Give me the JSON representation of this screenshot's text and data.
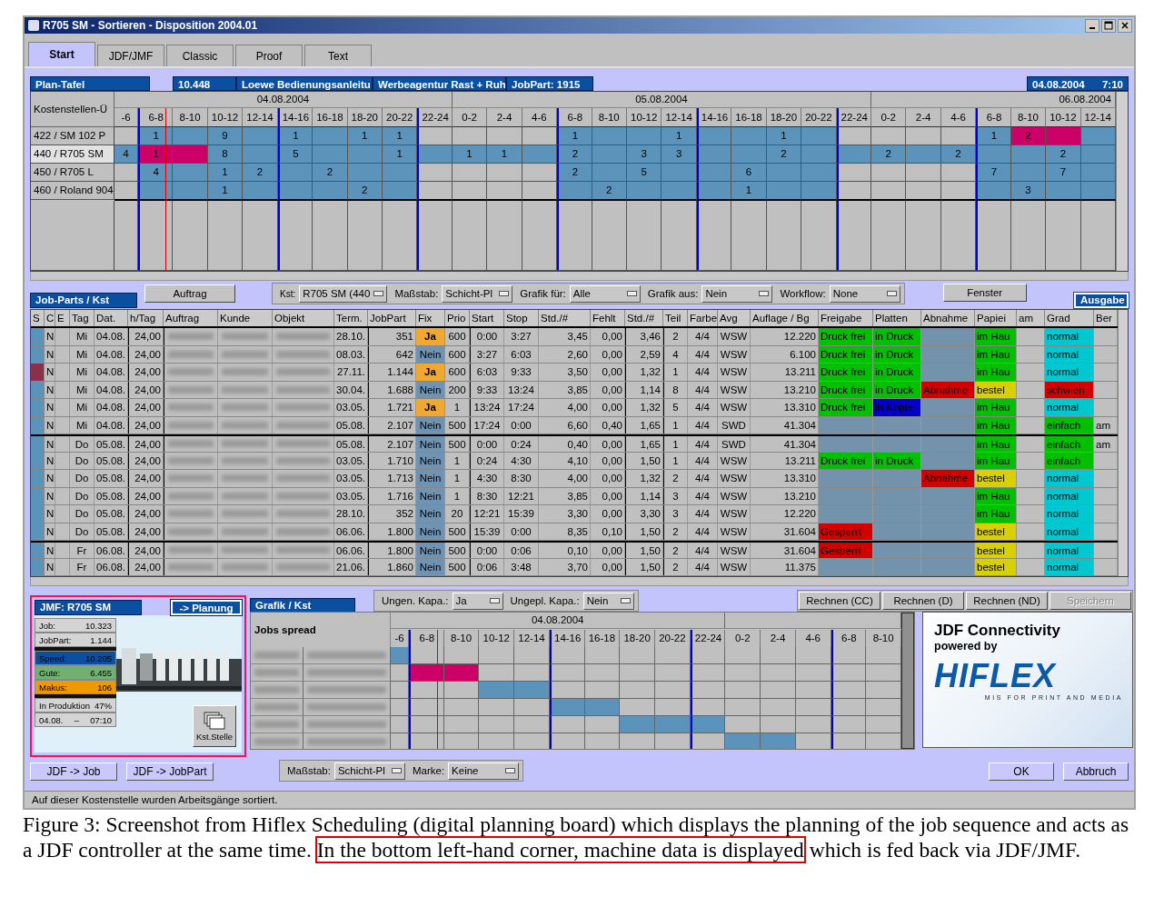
{
  "window": {
    "title": "R705 SM - Sortieren - Disposition 2004.01"
  },
  "tabs": [
    {
      "label": "Start",
      "selected": true
    },
    {
      "label": "JDF/JMF",
      "selected": false
    },
    {
      "label": "Classic",
      "selected": false
    },
    {
      "label": "Proof",
      "selected": false
    },
    {
      "label": "Text",
      "selected": false
    }
  ],
  "plan_header": {
    "title": "Plan-Tafel",
    "fields": [
      "10.448",
      "Loewe Bedienungsanleitu",
      "Werbeagentur Rast + Ruh",
      "JobPart: 1915"
    ],
    "date": "04.08.2004",
    "time": "7:10"
  },
  "plan_board": {
    "corner": "Kostenstellen-Ü",
    "days": [
      {
        "date": "04.08.2004",
        "slots": [
          "-6",
          "6-8",
          "8-10",
          "10-12",
          "12-14",
          "14-16",
          "16-18",
          "18-20",
          "20-22",
          "22-24"
        ]
      },
      {
        "date": "05.08.2004",
        "slots": [
          "0-2",
          "2-4",
          "4-6",
          "6-8",
          "8-10",
          "10-12",
          "12-14",
          "14-16",
          "16-18",
          "18-20",
          "20-22",
          "22-24"
        ]
      },
      {
        "date": "06.08.2004",
        "slots": [
          "0-2",
          "2-4",
          "4-6",
          "6-8",
          "8-10",
          "10-12",
          "12-14"
        ]
      }
    ],
    "rows": [
      {
        "label": "422 / SM 102 P",
        "selected": false,
        "cells": [
          {
            "kind": "idle"
          },
          {
            "kind": "busy",
            "label": "1"
          },
          {
            "kind": "busy"
          },
          {
            "kind": "busy",
            "label": "9"
          },
          {
            "kind": "busy"
          },
          {
            "kind": "busy",
            "label": "1"
          },
          {
            "kind": "busy"
          },
          {
            "kind": "busy",
            "label": "1"
          },
          {
            "kind": "busy",
            "label": "1"
          },
          {
            "kind": "idle"
          },
          {
            "kind": "idle"
          },
          {
            "kind": "idle"
          },
          {
            "kind": "idle"
          },
          {
            "kind": "busy",
            "label": "1"
          },
          {
            "kind": "busy"
          },
          {
            "kind": "busy"
          },
          {
            "kind": "busy",
            "label": "1"
          },
          {
            "kind": "busy"
          },
          {
            "kind": "busy"
          },
          {
            "kind": "busy",
            "label": "1"
          },
          {
            "kind": "busy"
          },
          {
            "kind": "idle"
          },
          {
            "kind": "idle"
          },
          {
            "kind": "idle"
          },
          {
            "kind": "idle"
          },
          {
            "kind": "busy",
            "label": "1"
          },
          {
            "kind": "alert",
            "label": "2"
          },
          {
            "kind": "alert"
          },
          {
            "kind": "busy"
          }
        ]
      },
      {
        "label": "440 / R705 SM",
        "selected": true,
        "cells": [
          {
            "kind": "busy",
            "label": "4"
          },
          {
            "kind": "alert",
            "label": "1"
          },
          {
            "kind": "alert"
          },
          {
            "kind": "busy",
            "label": "8"
          },
          {
            "kind": "busy"
          },
          {
            "kind": "busy",
            "label": "5"
          },
          {
            "kind": "busy"
          },
          {
            "kind": "busy"
          },
          {
            "kind": "busy",
            "label": "1"
          },
          {
            "kind": "busy"
          },
          {
            "kind": "busy",
            "label": "1"
          },
          {
            "kind": "busy",
            "label": "1"
          },
          {
            "kind": "busy"
          },
          {
            "kind": "busy",
            "label": "2"
          },
          {
            "kind": "busy"
          },
          {
            "kind": "busy",
            "label": "3"
          },
          {
            "kind": "busy",
            "label": "3"
          },
          {
            "kind": "busy"
          },
          {
            "kind": "busy"
          },
          {
            "kind": "busy",
            "label": "2"
          },
          {
            "kind": "busy"
          },
          {
            "kind": "busy"
          },
          {
            "kind": "busy",
            "label": "2"
          },
          {
            "kind": "busy"
          },
          {
            "kind": "busy",
            "label": "2"
          },
          {
            "kind": "busy"
          },
          {
            "kind": "busy"
          },
          {
            "kind": "busy",
            "label": "2"
          },
          {
            "kind": "busy"
          }
        ]
      },
      {
        "label": "450 / R705 L",
        "selected": false,
        "cells": [
          {
            "kind": "idle"
          },
          {
            "kind": "busy",
            "label": "4"
          },
          {
            "kind": "busy"
          },
          {
            "kind": "busy",
            "label": "1"
          },
          {
            "kind": "busy",
            "label": "2"
          },
          {
            "kind": "busy"
          },
          {
            "kind": "busy",
            "label": "2"
          },
          {
            "kind": "busy"
          },
          {
            "kind": "busy"
          },
          {
            "kind": "idle"
          },
          {
            "kind": "idle"
          },
          {
            "kind": "idle"
          },
          {
            "kind": "idle"
          },
          {
            "kind": "busy",
            "label": "2"
          },
          {
            "kind": "busy"
          },
          {
            "kind": "busy",
            "label": "5"
          },
          {
            "kind": "busy"
          },
          {
            "kind": "busy"
          },
          {
            "kind": "busy",
            "label": "6"
          },
          {
            "kind": "busy"
          },
          {
            "kind": "busy"
          },
          {
            "kind": "idle"
          },
          {
            "kind": "idle"
          },
          {
            "kind": "idle"
          },
          {
            "kind": "idle"
          },
          {
            "kind": "busy",
            "label": "7"
          },
          {
            "kind": "busy"
          },
          {
            "kind": "busy",
            "label": "7"
          },
          {
            "kind": "busy"
          }
        ]
      },
      {
        "label": "460 / Roland 904",
        "selected": false,
        "cells": [
          {
            "kind": "idle"
          },
          {
            "kind": "busy"
          },
          {
            "kind": "busy"
          },
          {
            "kind": "busy",
            "label": "1"
          },
          {
            "kind": "busy"
          },
          {
            "kind": "busy"
          },
          {
            "kind": "busy"
          },
          {
            "kind": "busy",
            "label": "2"
          },
          {
            "kind": "busy"
          },
          {
            "kind": "idle"
          },
          {
            "kind": "idle"
          },
          {
            "kind": "idle"
          },
          {
            "kind": "idle"
          },
          {
            "kind": "busy"
          },
          {
            "kind": "busy",
            "label": "2"
          },
          {
            "kind": "busy"
          },
          {
            "kind": "busy"
          },
          {
            "kind": "busy"
          },
          {
            "kind": "busy",
            "label": "1"
          },
          {
            "kind": "busy"
          },
          {
            "kind": "busy"
          },
          {
            "kind": "idle"
          },
          {
            "kind": "idle"
          },
          {
            "kind": "idle"
          },
          {
            "kind": "idle"
          },
          {
            "kind": "busy"
          },
          {
            "kind": "busy",
            "label": "3"
          },
          {
            "kind": "busy"
          },
          {
            "kind": "busy"
          }
        ]
      }
    ]
  },
  "toolbar": {
    "order_button": "Auftrag",
    "dropdowns": [
      {
        "label": "Kst:",
        "value": "R705 SM (440",
        "small": true
      },
      {
        "label": "Maßstab:",
        "value": "Schicht-Pl",
        "small": false
      },
      {
        "label": "Grafik für:",
        "value": "Alle",
        "small": false
      },
      {
        "label": "Grafik aus:",
        "value": "Nein",
        "small": false
      },
      {
        "label": "Workflow:",
        "value": "None",
        "small": false
      }
    ],
    "window_button": "Fenster"
  },
  "job_parts": {
    "title": "Job-Parts / Kst",
    "output_tab": "Ausgabe",
    "columns": [
      "S",
      "C",
      "E",
      "Tag",
      "Dat.",
      "h/Tag",
      "Auftrag",
      "Kunde",
      "Objekt",
      "Term.",
      "JobPart",
      "Fix",
      "Prio",
      "Start",
      "Stop",
      "Std./#",
      "Fehlt",
      "Std./#",
      "Teil",
      "Farbe",
      "Avg",
      "Auflage / Bg",
      "Freigabe",
      "Platten",
      "Abnahme",
      "Papiei",
      "am",
      "Grad",
      "Ber"
    ],
    "rows": [
      {
        "color": "#5b93bb",
        "c": "N",
        "day": "Mi",
        "date": "04.08.",
        "hours": "24,00",
        "term": "28.10.",
        "jobpart": "351",
        "fix": {
          "text": "Ja",
          "on": true
        },
        "prio": "600",
        "start": "0:00",
        "stop": "3:27",
        "std": "3,45",
        "missing": "0,00",
        "std_per": "3,46",
        "part": "2",
        "inks": "4/4",
        "avg": "WSW",
        "run": "12.220",
        "release": {
          "text": "Druck frei",
          "color": "#00c000"
        },
        "plates": {
          "text": "in Druck",
          "color": "#00c000"
        },
        "proof": {
          "color": "#7393ad"
        },
        "paper": {
          "text": "im Hau",
          "color": "#00c000"
        },
        "grade": {
          "text": "normal",
          "color": "#00c8d0"
        }
      },
      {
        "color": "#5b93bb",
        "c": "N",
        "day": "Mi",
        "date": "04.08.",
        "hours": "24,00",
        "term": "08.03.",
        "jobpart": "642",
        "fix": {
          "text": "Nein",
          "on": false
        },
        "prio": "600",
        "start": "3:27",
        "stop": "6:03",
        "std": "2,60",
        "missing": "0,00",
        "std_per": "2,59",
        "part": "4",
        "inks": "4/4",
        "avg": "WSW",
        "run": "6.100",
        "release": {
          "text": "Druck frei",
          "color": "#00c000"
        },
        "plates": {
          "text": "in Druck",
          "color": "#00c000"
        },
        "proof": {
          "color": "#7393ad"
        },
        "paper": {
          "text": "im Hau",
          "color": "#00c000"
        },
        "grade": {
          "text": "normal",
          "color": "#00c8d0"
        }
      },
      {
        "color": "#8a3048",
        "c": "N",
        "day": "Mi",
        "date": "04.08.",
        "hours": "24,00",
        "term": "27.11.",
        "jobpart": "1.144",
        "fix": {
          "text": "Ja",
          "on": true
        },
        "prio": "600",
        "start": "6:03",
        "stop": "9:33",
        "std": "3,50",
        "missing": "0,00",
        "std_per": "1,32",
        "part": "1",
        "inks": "4/4",
        "avg": "WSW",
        "run": "13.211",
        "release": {
          "text": "Druck frei",
          "color": "#00c000"
        },
        "plates": {
          "text": "in Druck",
          "color": "#00c000"
        },
        "proof": {
          "color": "#7393ad"
        },
        "paper": {
          "text": "im Hau",
          "color": "#00c000"
        },
        "grade": {
          "text": "normal",
          "color": "#00c8d0"
        }
      },
      {
        "color": "#5b93bb",
        "c": "N",
        "day": "Mi",
        "date": "04.08.",
        "hours": "24,00",
        "term": "30.04.",
        "jobpart": "1.688",
        "fix": {
          "text": "Nein",
          "on": false
        },
        "prio": "200",
        "start": "9:33",
        "stop": "13:24",
        "std": "3,85",
        "missing": "0,00",
        "std_per": "1,14",
        "part": "8",
        "inks": "4/4",
        "avg": "WSW",
        "run": "13.210",
        "release": {
          "text": "Druck frei",
          "color": "#00c000"
        },
        "plates": {
          "text": "in Druck",
          "color": "#00c000"
        },
        "proof": {
          "text": "Abnahme",
          "color": "#d40000"
        },
        "paper": {
          "text": "bestel",
          "color": "#d8d000"
        },
        "grade": {
          "text": "schwieri",
          "color": "#d40000"
        }
      },
      {
        "color": "#5b93bb",
        "c": "N",
        "day": "Mi",
        "date": "04.08.",
        "hours": "24,00",
        "term": "03.05.",
        "jobpart": "1.721",
        "fix": {
          "text": "Ja",
          "on": true
        },
        "prio": "1",
        "start": "13:24",
        "stop": "17:24",
        "std": "4,00",
        "missing": "0,00",
        "std_per": "1,32",
        "part": "5",
        "inks": "4/4",
        "avg": "WSW",
        "run": "13.310",
        "release": {
          "text": "Druck frei",
          "color": "#00c000"
        },
        "plates": {
          "text": "in Kopie",
          "color": "#0000c8"
        },
        "proof": {
          "color": "#7393ad"
        },
        "paper": {
          "text": "im Hau",
          "color": "#00c000"
        },
        "grade": {
          "text": "normal",
          "color": "#00c8d0"
        }
      },
      {
        "color": "#5b93bb",
        "c": "N",
        "day": "Mi",
        "date": "04.08.",
        "hours": "24,00",
        "term": "05.08.",
        "jobpart": "2.107",
        "fix": {
          "text": "Nein",
          "on": false
        },
        "prio": "500",
        "start": "17:24",
        "stop": "0:00",
        "std": "6,60",
        "missing": "0,40",
        "std_per": "1,65",
        "part": "1",
        "inks": "4/4",
        "avg": "SWD",
        "run": "41.304",
        "release": {
          "color": "#7393ad"
        },
        "plates": {
          "color": "#7393ad"
        },
        "proof": {
          "color": "#7393ad"
        },
        "paper": {
          "text": "im Hau",
          "color": "#00c000"
        },
        "grade": {
          "text": "einfach",
          "color": "#00c000"
        },
        "ber": "am"
      },
      {
        "color": "#5b93bb",
        "c": "N",
        "day": "Do",
        "date": "05.08.",
        "hours": "24,00",
        "term": "05.08.",
        "jobpart": "2.107",
        "fix": {
          "text": "Nein",
          "on": false
        },
        "prio": "500",
        "start": "0:00",
        "stop": "0:24",
        "std": "0,40",
        "missing": "0,00",
        "std_per": "1,65",
        "part": "1",
        "inks": "4/4",
        "avg": "SWD",
        "run": "41.304",
        "release": {
          "color": "#7393ad"
        },
        "plates": {
          "color": "#7393ad"
        },
        "proof": {
          "color": "#7393ad"
        },
        "paper": {
          "text": "im Hau",
          "color": "#00c000"
        },
        "grade": {
          "text": "einfach",
          "color": "#00c000"
        },
        "ber": "am"
      },
      {
        "color": "#5b93bb",
        "c": "N",
        "day": "Do",
        "date": "05.08.",
        "hours": "24,00",
        "term": "03.05.",
        "jobpart": "1.710",
        "fix": {
          "text": "Nein",
          "on": false
        },
        "prio": "1",
        "start": "0:24",
        "stop": "4:30",
        "std": "4,10",
        "missing": "0,00",
        "std_per": "1,50",
        "part": "1",
        "inks": "4/4",
        "avg": "WSW",
        "run": "13.211",
        "release": {
          "text": "Druck frei",
          "color": "#00c000"
        },
        "plates": {
          "text": "in Druck",
          "color": "#00c000"
        },
        "proof": {
          "color": "#7393ad"
        },
        "paper": {
          "text": "im Hau",
          "color": "#00c000"
        },
        "grade": {
          "text": "einfach",
          "color": "#00c000"
        }
      },
      {
        "color": "#5b93bb",
        "c": "N",
        "day": "Do",
        "date": "05.08.",
        "hours": "24,00",
        "term": "03.05.",
        "jobpart": "1.713",
        "fix": {
          "text": "Nein",
          "on": false
        },
        "prio": "1",
        "start": "4:30",
        "stop": "8:30",
        "std": "4,00",
        "missing": "0,00",
        "std_per": "1,32",
        "part": "2",
        "inks": "4/4",
        "avg": "WSW",
        "run": "13.310",
        "release": {
          "color": "#7393ad"
        },
        "plates": {
          "color": "#7393ad"
        },
        "proof": {
          "text": "Abnahme",
          "color": "#d40000"
        },
        "paper": {
          "text": "bestel",
          "color": "#d8d000"
        },
        "grade": {
          "text": "normal",
          "color": "#00c8d0"
        }
      },
      {
        "color": "#5b93bb",
        "c": "N",
        "day": "Do",
        "date": "05.08.",
        "hours": "24,00",
        "term": "03.05.",
        "jobpart": "1.716",
        "fix": {
          "text": "Nein",
          "on": false
        },
        "prio": "1",
        "start": "8:30",
        "stop": "12:21",
        "std": "3,85",
        "missing": "0,00",
        "std_per": "1,14",
        "part": "3",
        "inks": "4/4",
        "avg": "WSW",
        "run": "13.210",
        "release": {
          "color": "#7393ad"
        },
        "plates": {
          "color": "#7393ad"
        },
        "proof": {
          "color": "#7393ad"
        },
        "paper": {
          "text": "im Hau",
          "color": "#00c000"
        },
        "grade": {
          "text": "normal",
          "color": "#00c8d0"
        }
      },
      {
        "color": "#5b93bb",
        "c": "N",
        "day": "Do",
        "date": "05.08.",
        "hours": "24,00",
        "term": "28.10.",
        "jobpart": "352",
        "fix": {
          "text": "Nein",
          "on": false
        },
        "prio": "20",
        "start": "12:21",
        "stop": "15:39",
        "std": "3,30",
        "missing": "0,00",
        "std_per": "3,30",
        "part": "3",
        "inks": "4/4",
        "avg": "WSW",
        "run": "12.220",
        "release": {
          "color": "#7393ad"
        },
        "plates": {
          "color": "#7393ad"
        },
        "proof": {
          "color": "#7393ad"
        },
        "paper": {
          "text": "im Hau",
          "color": "#00c000"
        },
        "grade": {
          "text": "normal",
          "color": "#00c8d0"
        }
      },
      {
        "color": "#5b93bb",
        "c": "N",
        "day": "Do",
        "date": "05.08.",
        "hours": "24,00",
        "term": "06.06.",
        "jobpart": "1.800",
        "fix": {
          "text": "Nein",
          "on": false
        },
        "prio": "500",
        "start": "15:39",
        "stop": "0:00",
        "std": "8,35",
        "missing": "0,10",
        "std_per": "1,50",
        "part": "2",
        "inks": "4/4",
        "avg": "WSW",
        "run": "31.604",
        "release": {
          "text": "Gesperrt",
          "color": "#d40000"
        },
        "plates": {
          "color": "#7393ad"
        },
        "proof": {
          "color": "#7393ad"
        },
        "paper": {
          "text": "bestel",
          "color": "#d8d000"
        },
        "grade": {
          "text": "normal",
          "color": "#00c8d0"
        }
      },
      {
        "color": "#5b93bb",
        "c": "N",
        "day": "Fr",
        "date": "06.08.",
        "hours": "24,00",
        "term": "06.06.",
        "jobpart": "1.800",
        "fix": {
          "text": "Nein",
          "on": false
        },
        "prio": "500",
        "start": "0:00",
        "stop": "0:06",
        "std": "0,10",
        "missing": "0,00",
        "std_per": "1,50",
        "part": "2",
        "inks": "4/4",
        "avg": "WSW",
        "run": "31.604",
        "release": {
          "text": "Gesperrt",
          "color": "#d40000"
        },
        "plates": {
          "color": "#7393ad"
        },
        "proof": {
          "color": "#7393ad"
        },
        "paper": {
          "text": "bestel",
          "color": "#d8d000"
        },
        "grade": {
          "text": "normal",
          "color": "#00c8d0"
        }
      },
      {
        "color": "#5b93bb",
        "c": "N",
        "day": "Fr",
        "date": "06.08.",
        "hours": "24,00",
        "term": "21.06.",
        "jobpart": "1.860",
        "fix": {
          "text": "Nein",
          "on": false
        },
        "prio": "500",
        "start": "0:06",
        "stop": "3:48",
        "std": "3,70",
        "missing": "0,00",
        "std_per": "1,50",
        "part": "2",
        "inks": "4/4",
        "avg": "WSW",
        "run": "11.375",
        "release": {
          "color": "#7393ad"
        },
        "plates": {
          "color": "#7393ad"
        },
        "proof": {
          "color": "#7393ad"
        },
        "paper": {
          "text": "bestel",
          "color": "#d8d000"
        },
        "grade": {
          "text": "normal",
          "color": "#00c8d0"
        }
      }
    ]
  },
  "capacity": [
    {
      "label": "Ungen. Kapa.:",
      "value": "Ja"
    },
    {
      "label": "Ungepl. Kapa.:",
      "value": "Nein"
    }
  ],
  "action_buttons": [
    {
      "label": "Rechnen (CC)",
      "disabled": false
    },
    {
      "label": "Rechnen (D)",
      "disabled": false
    },
    {
      "label": "Rechnen (ND)",
      "disabled": false
    },
    {
      "label": "Speichern",
      "disabled": true
    }
  ],
  "jmf_panel": {
    "title": "JMF: R705 SM",
    "annotated": true,
    "planning_button": "-> Planung",
    "stats": [
      {
        "kind": "pair",
        "label": "Job:",
        "value": "10.323"
      },
      {
        "kind": "pair",
        "label": "JobPart:",
        "value": "1.144"
      },
      {
        "kind": "gap"
      },
      {
        "kind": "pair",
        "label": "Speed:",
        "value": "10.205",
        "color": "#0b4fa0"
      },
      {
        "kind": "pair",
        "label": "Gute:",
        "value": "6.455",
        "color": "#70b070"
      },
      {
        "kind": "pair",
        "label": "Makus:",
        "value": "106",
        "color": "#f09800"
      },
      {
        "kind": "gap"
      },
      {
        "kind": "pair",
        "label": "In Produktion",
        "value": "47%"
      },
      {
        "kind": "range",
        "label": "04.08.",
        "separator": "–",
        "value": "07:10"
      }
    ],
    "station_button": "Kst.Stelle"
  },
  "graphic_panel": {
    "title": "Grafik / Kst",
    "heading": "Jobs spread",
    "date": "04.08.2004",
    "slots": [
      "-6",
      "6-8",
      "8-10",
      "10-12",
      "12-14",
      "14-16",
      "16-18",
      "18-20",
      "20-22",
      "22-24",
      "0-2",
      "2-4",
      "4-6",
      "6-8",
      "8-10"
    ],
    "rows": [
      {
        "cells": [
          {
            "kind": "busy"
          },
          {
            "kind": "idle"
          },
          {
            "kind": "idle"
          },
          {
            "kind": "idle"
          },
          {
            "kind": "idle"
          },
          {
            "kind": "idle"
          },
          {
            "kind": "idle"
          },
          {
            "kind": "idle"
          },
          {
            "kind": "idle"
          },
          {
            "kind": "idle"
          },
          {
            "kind": "idle"
          },
          {
            "kind": "idle"
          },
          {
            "kind": "idle"
          },
          {
            "kind": "idle"
          },
          {
            "kind": "idle"
          }
        ]
      },
      {
        "cells": [
          {
            "kind": "idle"
          },
          {
            "kind": "alert"
          },
          {
            "kind": "alert"
          },
          {
            "kind": "idle"
          },
          {
            "kind": "idle"
          },
          {
            "kind": "idle"
          },
          {
            "kind": "idle"
          },
          {
            "kind": "idle"
          },
          {
            "kind": "idle"
          },
          {
            "kind": "idle"
          },
          {
            "kind": "idle"
          },
          {
            "kind": "idle"
          },
          {
            "kind": "idle"
          },
          {
            "kind": "idle"
          },
          {
            "kind": "idle"
          }
        ]
      },
      {
        "cells": [
          {
            "kind": "idle"
          },
          {
            "kind": "idle"
          },
          {
            "kind": "idle"
          },
          {
            "kind": "busy"
          },
          {
            "kind": "busy"
          },
          {
            "kind": "idle"
          },
          {
            "kind": "idle"
          },
          {
            "kind": "idle"
          },
          {
            "kind": "idle"
          },
          {
            "kind": "idle"
          },
          {
            "kind": "idle"
          },
          {
            "kind": "idle"
          },
          {
            "kind": "idle"
          },
          {
            "kind": "idle"
          },
          {
            "kind": "idle"
          }
        ]
      },
      {
        "cells": [
          {
            "kind": "idle"
          },
          {
            "kind": "idle"
          },
          {
            "kind": "idle"
          },
          {
            "kind": "idle"
          },
          {
            "kind": "idle"
          },
          {
            "kind": "busy"
          },
          {
            "kind": "busy"
          },
          {
            "kind": "idle"
          },
          {
            "kind": "idle"
          },
          {
            "kind": "idle"
          },
          {
            "kind": "idle"
          },
          {
            "kind": "idle"
          },
          {
            "kind": "idle"
          },
          {
            "kind": "idle"
          },
          {
            "kind": "idle"
          }
        ]
      },
      {
        "cells": [
          {
            "kind": "idle"
          },
          {
            "kind": "idle"
          },
          {
            "kind": "idle"
          },
          {
            "kind": "idle"
          },
          {
            "kind": "idle"
          },
          {
            "kind": "idle"
          },
          {
            "kind": "idle"
          },
          {
            "kind": "busy"
          },
          {
            "kind": "busy"
          },
          {
            "kind": "busy"
          },
          {
            "kind": "idle"
          },
          {
            "kind": "idle"
          },
          {
            "kind": "idle"
          },
          {
            "kind": "idle"
          },
          {
            "kind": "idle"
          }
        ]
      },
      {
        "cells": [
          {
            "kind": "idle"
          },
          {
            "kind": "idle"
          },
          {
            "kind": "idle"
          },
          {
            "kind": "idle"
          },
          {
            "kind": "idle"
          },
          {
            "kind": "idle"
          },
          {
            "kind": "idle"
          },
          {
            "kind": "idle"
          },
          {
            "kind": "idle"
          },
          {
            "kind": "idle"
          },
          {
            "kind": "busy"
          },
          {
            "kind": "busy"
          },
          {
            "kind": "idle"
          },
          {
            "kind": "idle"
          },
          {
            "kind": "idle"
          }
        ]
      }
    ]
  },
  "bottom_dropdowns": [
    {
      "label": "Maßstab:",
      "value": "Schicht-Pl"
    },
    {
      "label": "Marke:",
      "value": "Keine"
    }
  ],
  "jdf_buttons": [
    "JDF -> Job",
    "JDF -> JobPart"
  ],
  "logo_panel": {
    "heading": "JDF Connectivity",
    "subheading": "powered by",
    "brand": "HIFLEX",
    "tagline": "MIS FOR PRINT AND MEDIA"
  },
  "dialog_buttons": [
    "OK",
    "Abbruch"
  ],
  "status_bar": "Auf dieser Kostenstelle wurden  Arbeitsgänge sortiert.",
  "caption": {
    "before": "Figure 3: Screenshot from Hiflex Scheduling (digital planning board) which displays the planning of the job sequence and acts as a JDF controller at the same time. ",
    "marked": "In the bottom left-hand corner, machine data is displayed",
    "after": " which is fed back via JDF/JMF."
  }
}
